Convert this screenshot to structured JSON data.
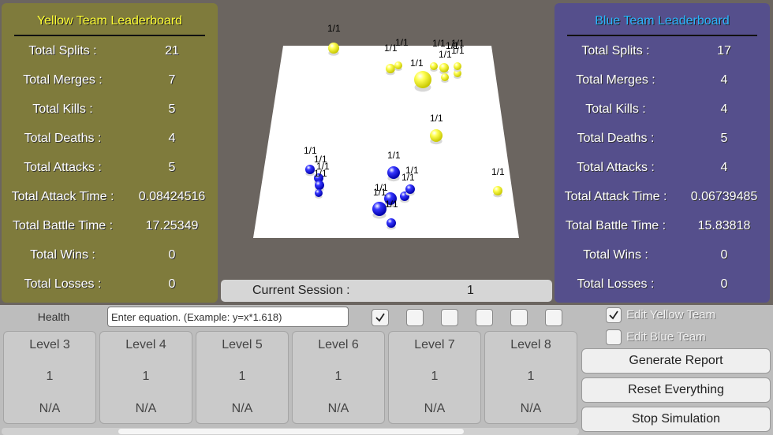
{
  "yellow_board": {
    "title": "Yellow Team Leaderboard",
    "stats": [
      {
        "label": "Total Splits :",
        "value": "21"
      },
      {
        "label": "Total Merges :",
        "value": "7"
      },
      {
        "label": "Total Kills :",
        "value": "5"
      },
      {
        "label": "Total Deaths :",
        "value": "4"
      },
      {
        "label": "Total Attacks :",
        "value": "5"
      },
      {
        "label": "Total Attack Time :",
        "value": "0.08424516"
      },
      {
        "label": "Total Battle Time :",
        "value": "17.25349"
      },
      {
        "label": "Total Wins :",
        "value": "0"
      },
      {
        "label": "Total Losses :",
        "value": "0"
      }
    ]
  },
  "blue_board": {
    "title": "Blue Team Leaderboard",
    "stats": [
      {
        "label": "Total Splits :",
        "value": "17"
      },
      {
        "label": "Total Merges :",
        "value": "4"
      },
      {
        "label": "Total Kills :",
        "value": "4"
      },
      {
        "label": "Total Deaths :",
        "value": "5"
      },
      {
        "label": "Total Attacks :",
        "value": "4"
      },
      {
        "label": "Total Attack Time :",
        "value": "0.06739485"
      },
      {
        "label": "Total Battle Time :",
        "value": "15.83818"
      },
      {
        "label": "Total Wins :",
        "value": "0"
      },
      {
        "label": "Total Losses :",
        "value": "0"
      }
    ]
  },
  "session": {
    "label": "Current Session :",
    "value": "1"
  },
  "arena": {
    "unit_label": "1/1",
    "colors": {
      "yellow": "#ffff33",
      "blue": "#2a2aff",
      "floor": "#ffffff"
    }
  },
  "controls": {
    "health_label": "Health",
    "equation_placeholder": "Enter equation. (Example: y=x*1.618)",
    "equation_value": "",
    "checkboxes": [
      true,
      false,
      false,
      false,
      false,
      false
    ]
  },
  "levels": [
    {
      "name": "Level 3",
      "value": "1",
      "status": "N/A"
    },
    {
      "name": "Level 4",
      "value": "1",
      "status": "N/A"
    },
    {
      "name": "Level 5",
      "value": "1",
      "status": "N/A"
    },
    {
      "name": "Level 6",
      "value": "1",
      "status": "N/A"
    },
    {
      "name": "Level 7",
      "value": "1",
      "status": "N/A"
    },
    {
      "name": "Level 8",
      "value": "1",
      "status": "N/A"
    }
  ],
  "team_toggles": [
    {
      "label": "Edit Yellow Team",
      "checked": true
    },
    {
      "label": "Edit Blue Team",
      "checked": false
    }
  ],
  "actions": {
    "generate": "Generate Report",
    "reset": "Reset Everything",
    "stop": "Stop Simulation"
  }
}
